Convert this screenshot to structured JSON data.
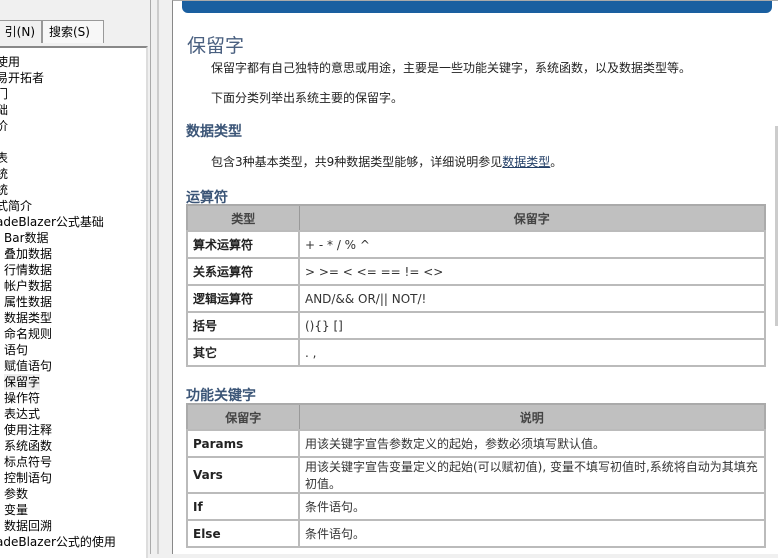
{
  "left_pane": {
    "tabs": [
      {
        "label": "引(N)"
      },
      {
        "label": "搜索(S)"
      }
    ],
    "tree_items": [
      {
        "label": "使用",
        "indent": 0
      },
      {
        "label": "易开拓者",
        "indent": 0
      },
      {
        "label": "门",
        "indent": 0
      },
      {
        "label": "础",
        "indent": 0
      },
      {
        "label": "价",
        "indent": 0
      },
      {
        "label": "]",
        "indent": 0
      },
      {
        "label": "表",
        "indent": 0
      },
      {
        "label": "统",
        "indent": 0
      },
      {
        "label": "统",
        "indent": 0
      },
      {
        "label": "式简介",
        "indent": 0
      },
      {
        "label": "adeBlazer公式基础",
        "indent": 0
      },
      {
        "label": "Bar数据",
        "indent": 1
      },
      {
        "label": "叠加数据",
        "indent": 1
      },
      {
        "label": "行情数据",
        "indent": 1
      },
      {
        "label": "帐户数据",
        "indent": 1
      },
      {
        "label": "属性数据",
        "indent": 1
      },
      {
        "label": "数据类型",
        "indent": 1
      },
      {
        "label": "命名规则",
        "indent": 1
      },
      {
        "label": "语句",
        "indent": 1
      },
      {
        "label": "赋值语句",
        "indent": 1
      },
      {
        "label": "保留字",
        "indent": 1,
        "selected": true
      },
      {
        "label": "操作符",
        "indent": 1
      },
      {
        "label": "表达式",
        "indent": 1
      },
      {
        "label": "使用注释",
        "indent": 1
      },
      {
        "label": "系统函数",
        "indent": 1
      },
      {
        "label": "标点符号",
        "indent": 1
      },
      {
        "label": "控制语句",
        "indent": 1
      },
      {
        "label": "参数",
        "indent": 1
      },
      {
        "label": "变量",
        "indent": 1
      },
      {
        "label": "数据回溯",
        "indent": 1
      },
      {
        "label": "adeBlazer公式的使用",
        "indent": 0
      }
    ]
  },
  "content": {
    "title": "保留字",
    "intro1": "保留字都有自己独特的意思或用途，主要是一些功能关键字，系统函数，以及数据类型等。",
    "intro2": "下面分类列举出系统主要的保留字。",
    "section_datatype": "数据类型",
    "datatype_text": "包含3种基本类型，共9种数据类型能够，详细说明参见",
    "datatype_link": "数据类型",
    "datatype_end": "。",
    "section_operators": "运算符",
    "operators_table": {
      "headers": [
        "类型",
        "保留字"
      ],
      "rows": [
        [
          "算术运算符",
          "+ - * / % ^"
        ],
        [
          "关系运算符",
          "> >= < <= == != <>"
        ],
        [
          "逻辑运算符",
          "AND/&& OR/|| NOT/!"
        ],
        [
          "括号",
          "(){} []"
        ],
        [
          "其它",
          ". ,"
        ]
      ]
    },
    "section_keywords": "功能关键字",
    "keywords_table": {
      "headers": [
        "保留字",
        "说明"
      ],
      "rows": [
        [
          "Params",
          "用该关键字宣告参数定义的起始，参数必须填写默认值。"
        ],
        [
          "Vars",
          "用该关键字宣告变量定义的起始(可以赋初值), 变量不填写初值时,系统将自动为其填充初值。"
        ],
        [
          "If",
          "条件语句。"
        ],
        [
          "Else",
          "条件语句。"
        ]
      ]
    }
  }
}
